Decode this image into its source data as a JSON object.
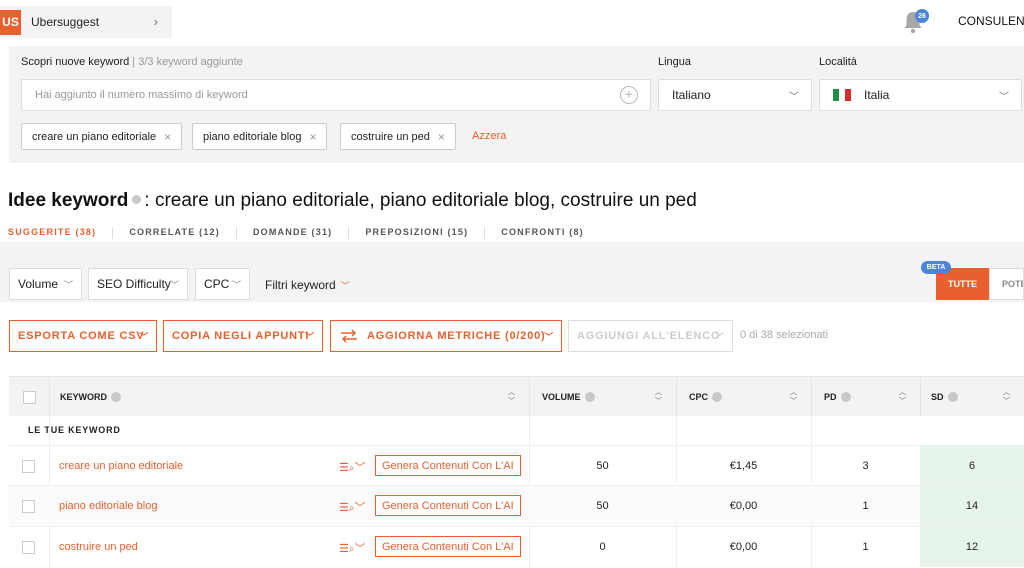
{
  "topbar": {
    "project_badge": "US",
    "project_name": "Ubersuggest",
    "notifications_count": "26",
    "user_label": "CONSULENZ"
  },
  "search": {
    "label": "Scopri nuove keyword",
    "sublabel": "3/3 keyword aggiunte",
    "placeholder": "Hai aggiunto il numero massimo di keyword",
    "language_label": "Lingua",
    "language_value": "Italiano",
    "location_label": "Località",
    "location_value": "Italia",
    "chips": [
      "creare un piano editoriale",
      "piano editoriale blog",
      "costruire un ped"
    ],
    "reset_label": "Azzera"
  },
  "heading": {
    "title": "Idee keyword",
    "query": ": creare un piano editoriale, piano editoriale blog, costruire un ped"
  },
  "tabs": [
    {
      "label": "SUGGERITE (38)",
      "active": true
    },
    {
      "label": "CORRELATE (12)",
      "active": false
    },
    {
      "label": "DOMANDE (31)",
      "active": false
    },
    {
      "label": "PREPOSIZIONI (15)",
      "active": false
    },
    {
      "label": "CONFRONTI (8)",
      "active": false
    }
  ],
  "filters": {
    "volume": "Volume",
    "seo_difficulty": "SEO Difficulty",
    "cpc": "CPC",
    "keyword_filters": "Filtri keyword",
    "beta_badge": "BETA",
    "tutte": "TUTTE",
    "pote": "POTE"
  },
  "actions": {
    "export": "ESPORTA COME CSV",
    "copy": "COPIA NEGLI APPUNTI",
    "update": "AGGIORNA METRICHE (0/200)",
    "add_list": "AGGIUNGI ALL'ELENCO",
    "selected_count": "0 di 38 selezionati"
  },
  "table": {
    "headers": {
      "keyword": "KEYWORD",
      "volume": "VOLUME",
      "cpc": "CPC",
      "pd": "PD",
      "sd": "SD"
    },
    "group_label": "LE TUE KEYWORD",
    "generate_label": "Genera Contenuti Con L'AI",
    "rows": [
      {
        "keyword": "creare un piano editoriale",
        "volume": "50",
        "cpc": "€1,45",
        "pd": "3",
        "sd": "6"
      },
      {
        "keyword": "piano editoriale blog",
        "volume": "50",
        "cpc": "€0,00",
        "pd": "1",
        "sd": "14"
      },
      {
        "keyword": "costruire un ped",
        "volume": "0",
        "cpc": "€0,00",
        "pd": "1",
        "sd": "12"
      }
    ]
  },
  "colors": {
    "accent": "#e9602f",
    "info_blue": "#4c84d9",
    "sd_green_bg": "#e6f4ec"
  }
}
